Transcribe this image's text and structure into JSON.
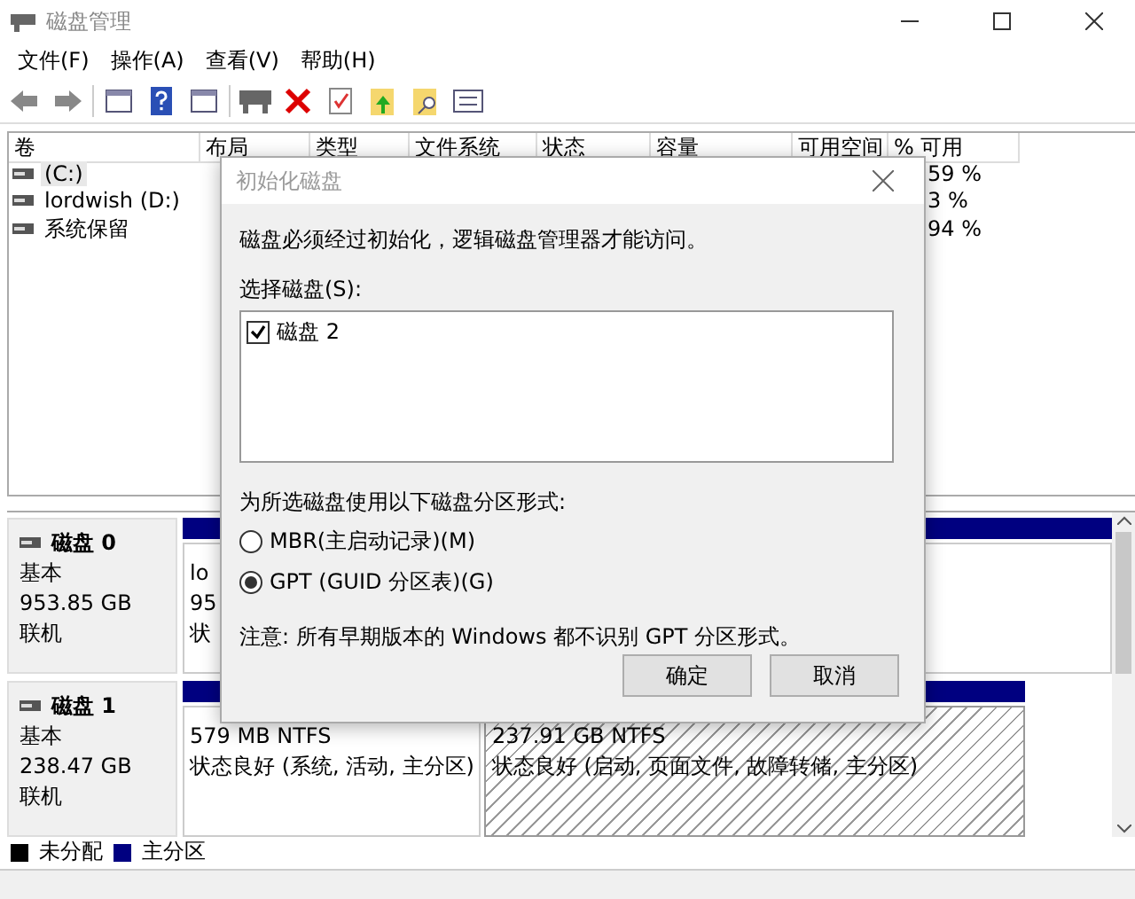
{
  "window": {
    "title": "磁盘管理"
  },
  "menu": [
    "文件(F)",
    "操作(A)",
    "查看(V)",
    "帮助(H)"
  ],
  "volume_table": {
    "columns": [
      "卷",
      "布局",
      "类型",
      "文件系统",
      "状态",
      "容量",
      "可用空间",
      "% 可用"
    ],
    "rows": [
      {
        "volume": "(C:)",
        "percent_free": "59 %",
        "selected": true
      },
      {
        "volume": "lordwish (D:)",
        "percent_free": "3 %",
        "selected": false
      },
      {
        "volume": "系统保留",
        "percent_free": "94 %",
        "selected": false
      }
    ]
  },
  "disks": [
    {
      "name": "磁盘 0",
      "type": "基本",
      "size": "953.85 GB",
      "status": "联机",
      "partitions": [
        {
          "lines": [
            "lo",
            "95",
            "状"
          ],
          "selected": false
        }
      ]
    },
    {
      "name": "磁盘 1",
      "type": "基本",
      "size": "238.47 GB",
      "status": "联机",
      "partitions": [
        {
          "lines": [
            "579 MB NTFS",
            "状态良好 (系统, 活动, 主分区)"
          ],
          "selected": false
        },
        {
          "lines": [
            "237.91 GB NTFS",
            "状态良好 (启动, 页面文件, 故障转储, 主分区)"
          ],
          "selected": true
        }
      ]
    }
  ],
  "legend": [
    {
      "label": "未分配",
      "color": "#000000"
    },
    {
      "label": "主分区",
      "color": "#000080"
    }
  ],
  "dialog": {
    "title": "初始化磁盘",
    "message": "磁盘必须经过初始化，逻辑磁盘管理器才能访问。",
    "disk_list_label": "选择磁盘(S):",
    "disks": [
      {
        "label": "磁盘 2",
        "checked": true
      }
    ],
    "style_label": "为所选磁盘使用以下磁盘分区形式:",
    "styles": [
      {
        "label": "MBR(主启动记录)(M)",
        "selected": false
      },
      {
        "label": "GPT (GUID 分区表)(G)",
        "selected": true
      }
    ],
    "note": "注意: 所有早期版本的 Windows 都不识别 GPT 分区形式。",
    "buttons": [
      "确定",
      "取消"
    ]
  }
}
